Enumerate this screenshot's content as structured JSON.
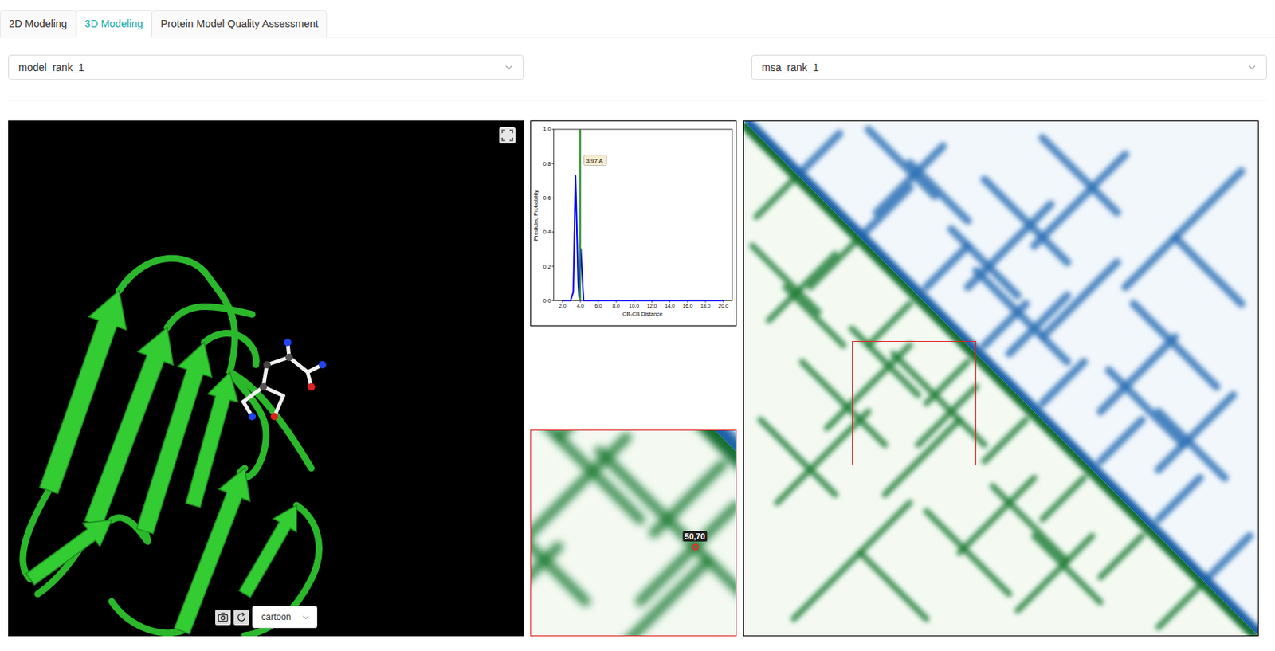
{
  "tabs": [
    {
      "label": "2D Modeling",
      "selected": false
    },
    {
      "label": "3D Modeling",
      "selected": true
    },
    {
      "label": "Protein Model Quality Assessment",
      "selected": false
    }
  ],
  "model_select": {
    "value": "model_rank_1"
  },
  "msa_select": {
    "value": "msa_rank_1"
  },
  "viewer": {
    "style_select": {
      "value": "cartoon"
    }
  },
  "distance_chart": {
    "y_label": "Predicted Probability",
    "x_label": "CB-CB Distance",
    "x_ticks": [
      "2.0",
      "4.0",
      "6.0",
      "8.0",
      "10.0",
      "12.0",
      "14.0",
      "16.0",
      "18.0",
      "20.0"
    ],
    "y_ticks": [
      "0.0",
      "0.2",
      "0.4",
      "0.6",
      "0.8",
      "1.0"
    ],
    "series": {
      "x": [
        2.0,
        2.9,
        3.2,
        3.45,
        3.75,
        3.85,
        4.05,
        4.35,
        5.0,
        20.0
      ],
      "y": [
        0,
        0,
        0.05,
        0.73,
        0.1,
        0.02,
        0.3,
        0,
        0,
        0
      ]
    },
    "marker": {
      "value": 3.97,
      "label": "3.97 A"
    }
  },
  "contact_map": {
    "residues": 124,
    "segments": [
      [
        3,
        23,
        12,
        14
      ],
      [
        16,
        40,
        27,
        29
      ],
      [
        30,
        54,
        40,
        44
      ],
      [
        44,
        68,
        54,
        58
      ],
      [
        58,
        82,
        68,
        72
      ],
      [
        72,
        96,
        82,
        86
      ],
      [
        86,
        110,
        96,
        100
      ],
      [
        100,
        122,
        110,
        112
      ],
      [
        6,
        48,
        22,
        32
      ],
      [
        20,
        74,
        40,
        54
      ],
      [
        34,
        90,
        52,
        72
      ],
      [
        42,
        78,
        56,
        64
      ],
      [
        52,
        104,
        70,
        86
      ],
      [
        66,
        118,
        84,
        100
      ],
      [
        8,
        92,
        30,
        70
      ],
      [
        12,
        120,
        40,
        92
      ],
      [
        2,
        30,
        18,
        46
      ],
      [
        14,
        58,
        34,
        78
      ],
      [
        26,
        50,
        42,
        66
      ],
      [
        36,
        56,
        58,
        78
      ],
      [
        44,
        94,
        64,
        114
      ],
      [
        60,
        88,
        78,
        106
      ],
      [
        4,
        72,
        22,
        90
      ],
      [
        28,
        104,
        44,
        120
      ],
      [
        70,
        100,
        86,
        116
      ],
      [
        10,
        40,
        24,
        54
      ]
    ],
    "selection": {
      "col": 26,
      "row": 53,
      "size": 30
    },
    "point": {
      "label": "50,70",
      "col": 50,
      "row": 70
    }
  }
}
